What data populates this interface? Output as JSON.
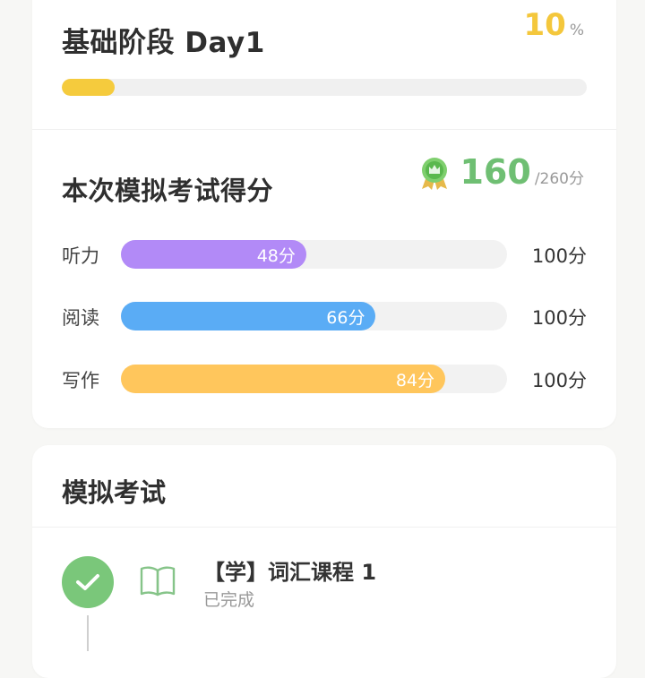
{
  "progress": {
    "title": "基础阶段 Day1",
    "value": 10,
    "value_text": "10",
    "unit": "%",
    "bar_color": "#f5cb3d"
  },
  "exam_score": {
    "title": "本次模拟考试得分",
    "total": "160",
    "max": "/260分",
    "medal_icon": "medal-icon",
    "accent": "#6fbf73"
  },
  "skills": [
    {
      "label": "听力",
      "score": 48,
      "score_text": "48分",
      "max_text": "100分",
      "max": 100,
      "color": "#b28af7"
    },
    {
      "label": "阅读",
      "score": 66,
      "score_text": "66分",
      "max_text": "100分",
      "max": 100,
      "color": "#5aacf5"
    },
    {
      "label": "写作",
      "score": 84,
      "score_text": "84分",
      "max_text": "100分",
      "max": 100,
      "color": "#ffc65c"
    }
  ],
  "mock_exam": {
    "title": "模拟考试",
    "lessons": [
      {
        "title": "【学】词汇课程 1",
        "status": "已完成",
        "check_icon": "check-icon",
        "book_icon": "book-icon"
      }
    ]
  }
}
